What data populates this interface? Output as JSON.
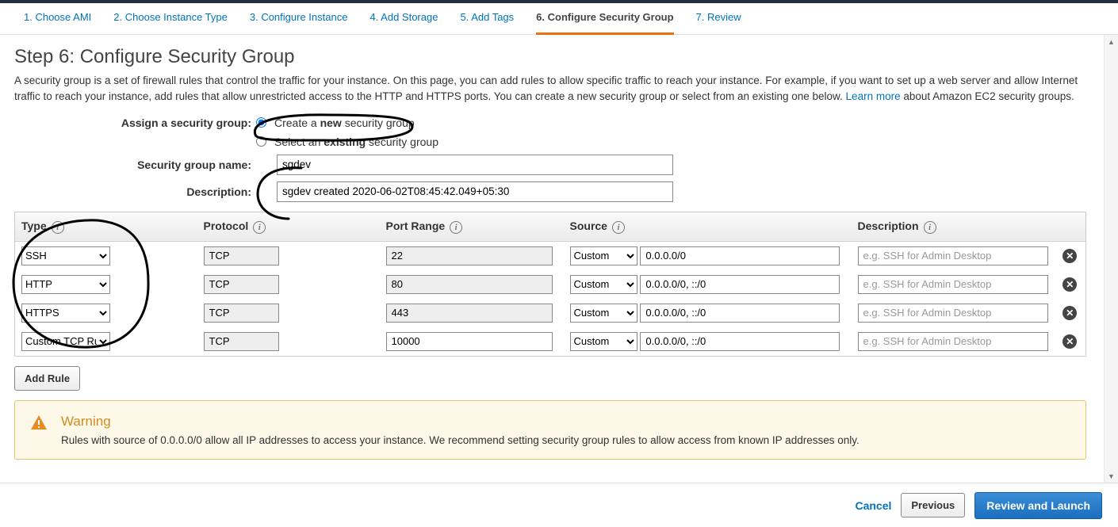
{
  "wizard": {
    "steps": [
      "1. Choose AMI",
      "2. Choose Instance Type",
      "3. Configure Instance",
      "4. Add Storage",
      "5. Add Tags",
      "6. Configure Security Group",
      "7. Review"
    ],
    "active_index": 5
  },
  "heading": "Step 6: Configure Security Group",
  "description_1": "A security group is a set of firewall rules that control the traffic for your instance. On this page, you can add rules to allow specific traffic to reach your instance. For example, if you want to set up a web server and allow Internet traffic to reach your instance, add rules that allow unrestricted access to the HTTP and HTTPS ports. You can create a new security group or select from an existing one below. ",
  "learn_more": "Learn more",
  "description_2": " about Amazon EC2 security groups.",
  "form": {
    "assign_label": "Assign a security group:",
    "radio_new_pre": "Create a ",
    "radio_new_b": "new",
    "radio_new_post": " security group",
    "radio_existing_pre": "Select an ",
    "radio_existing_b": "existing",
    "radio_existing_post": " security group",
    "name_label": "Security group name:",
    "name_value": "sgdev",
    "desc_label": "Description:",
    "desc_value": "sgdev created 2020-06-02T08:45:42.049+05:30"
  },
  "columns": {
    "type": "Type",
    "protocol": "Protocol",
    "port": "Port Range",
    "source": "Source",
    "description": "Description"
  },
  "rules": [
    {
      "type": "SSH",
      "protocol": "TCP",
      "port": "22",
      "port_editable": false,
      "source_type": "Custom",
      "source_cidr": "0.0.0.0/0",
      "desc": ""
    },
    {
      "type": "HTTP",
      "protocol": "TCP",
      "port": "80",
      "port_editable": false,
      "source_type": "Custom",
      "source_cidr": "0.0.0.0/0, ::/0",
      "desc": ""
    },
    {
      "type": "HTTPS",
      "protocol": "TCP",
      "port": "443",
      "port_editable": false,
      "source_type": "Custom",
      "source_cidr": "0.0.0.0/0, ::/0",
      "desc": ""
    },
    {
      "type": "Custom TCP Rule",
      "protocol": "TCP",
      "port": "10000",
      "port_editable": true,
      "source_type": "Custom",
      "source_cidr": "0.0.0.0/0, ::/0",
      "desc": ""
    }
  ],
  "desc_placeholder": "e.g. SSH for Admin Desktop",
  "add_rule_label": "Add Rule",
  "warning": {
    "title": "Warning",
    "text": "Rules with source of 0.0.0.0/0 allow all IP addresses to access your instance. We recommend setting security group rules to allow access from known IP addresses only."
  },
  "footer": {
    "cancel": "Cancel",
    "previous": "Previous",
    "review": "Review and Launch"
  }
}
